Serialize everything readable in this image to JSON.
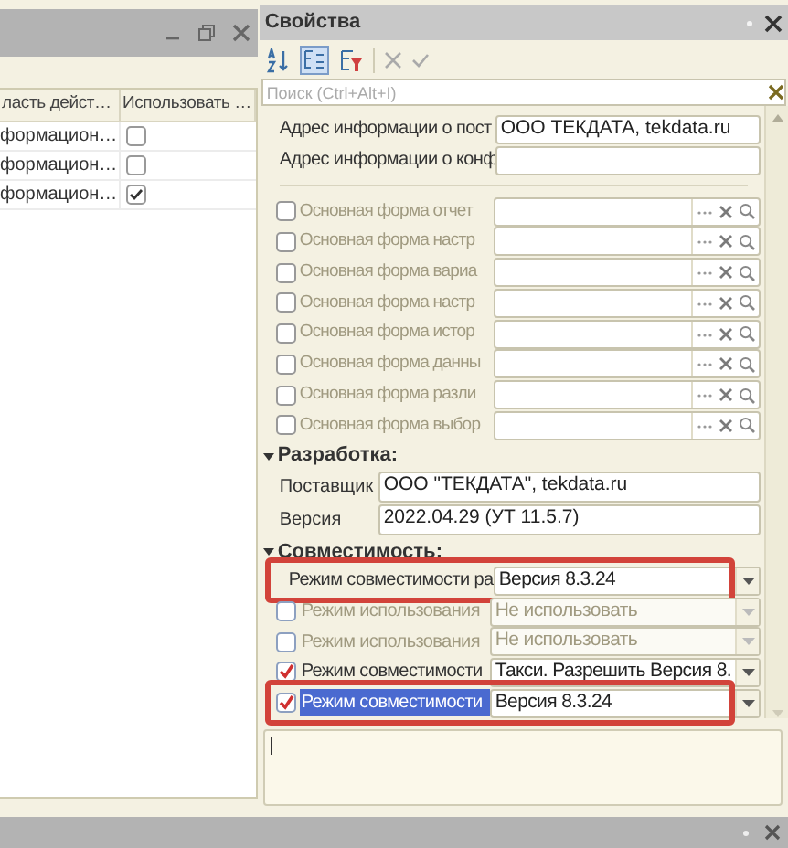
{
  "left_panel": {
    "columns": [
      "ласть дейст…",
      "Использовать …"
    ],
    "rows": [
      {
        "cell": "формацион…",
        "checked": false
      },
      {
        "cell": "формацион…",
        "checked": false
      },
      {
        "cell": "формацион…",
        "checked": true
      }
    ]
  },
  "properties": {
    "title": "Свойства",
    "search": {
      "placeholder": "Поиск (Ctrl+Alt+I)"
    },
    "fields": [
      {
        "label": "Адрес информации о пост",
        "value": "ООО ТЕКДАТА, tekdata.ru"
      },
      {
        "label": "Адрес информации о конф"
      }
    ],
    "forms": [
      {
        "label": "Основная форма отчет",
        "checked": false
      },
      {
        "label": "Основная форма настр",
        "checked": false
      },
      {
        "label": "Основная форма вариа",
        "checked": false
      },
      {
        "label": "Основная форма настр",
        "checked": false
      },
      {
        "label": "Основная форма истор",
        "checked": false
      },
      {
        "label": "Основная форма данны",
        "checked": false
      },
      {
        "label": "Основная форма разли",
        "checked": false
      },
      {
        "label": "Основная форма выбор",
        "checked": false
      }
    ],
    "sections": [
      {
        "title": "Разработка:",
        "expanded": true,
        "rows": [
          {
            "kind": "text",
            "label": "Поставщик",
            "value": "ООО \"ТЕКДАТА\", tekdata.ru"
          },
          {
            "kind": "text",
            "label": "Версия",
            "value": "2022.04.29 (УТ 11.5.7)"
          }
        ]
      },
      {
        "title": "Совместимость:",
        "expanded": true,
        "rows": [
          {
            "kind": "dropdown",
            "label": "Режим совместимости ра",
            "value": "Версия 8.3.24",
            "outlined": true,
            "selected": false,
            "disabled": false
          },
          {
            "kind": "check_dropdown",
            "label": "Режим использования",
            "value": "Не использовать",
            "checked": false,
            "disabled": true,
            "outlined": false,
            "selected": false
          },
          {
            "kind": "check_dropdown",
            "label": "Режим использования",
            "value": "Не использовать",
            "checked": false,
            "disabled": true,
            "outlined": false,
            "selected": false
          },
          {
            "kind": "check_dropdown",
            "label": "Режим совместимости",
            "value": "Такси. Разрешить Версия 8.",
            "checked": true,
            "disabled": false,
            "outlined": false,
            "selected": false
          },
          {
            "kind": "check_dropdown",
            "label": "Режим совместимости",
            "value": "Версия 8.3.24",
            "checked": true,
            "disabled": false,
            "outlined": true,
            "selected": true
          }
        ]
      }
    ]
  }
}
